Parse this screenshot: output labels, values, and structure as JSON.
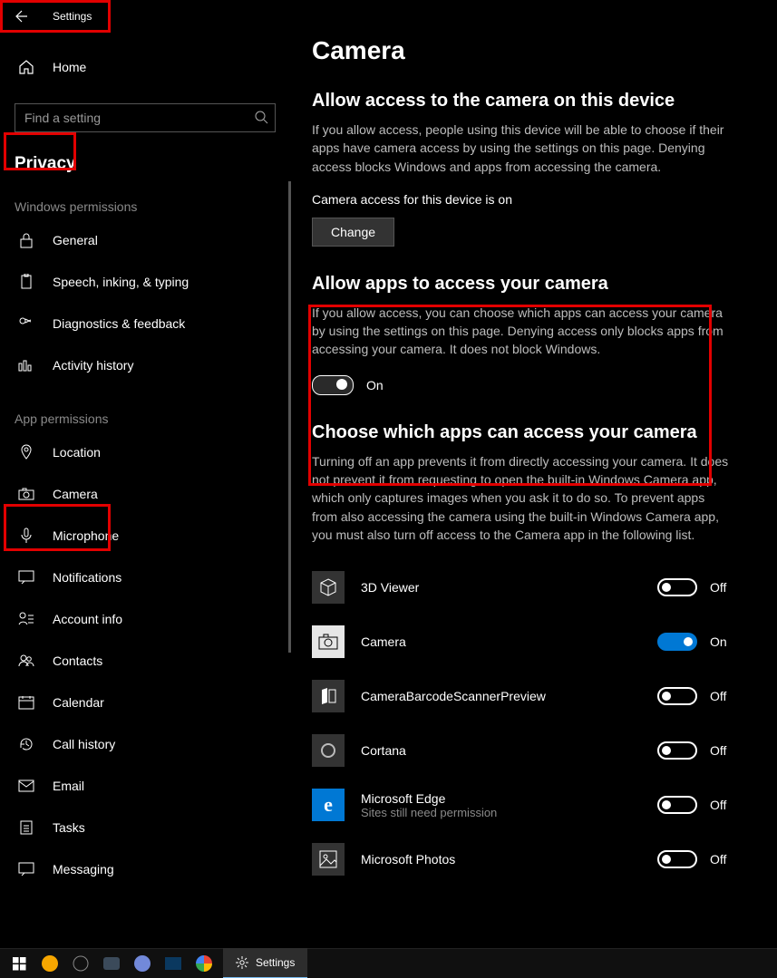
{
  "titlebar": {
    "title": "Settings"
  },
  "sidebar": {
    "home": "Home",
    "search_placeholder": "Find a setting",
    "crumb": "Privacy",
    "section1_label": "Windows permissions",
    "section1_items": [
      {
        "label": "General"
      },
      {
        "label": "Speech, inking, & typing"
      },
      {
        "label": "Diagnostics & feedback"
      },
      {
        "label": "Activity history"
      }
    ],
    "section2_label": "App permissions",
    "section2_items": [
      {
        "label": "Location"
      },
      {
        "label": "Camera"
      },
      {
        "label": "Microphone"
      },
      {
        "label": "Notifications"
      },
      {
        "label": "Account info"
      },
      {
        "label": "Contacts"
      },
      {
        "label": "Calendar"
      },
      {
        "label": "Call history"
      },
      {
        "label": "Email"
      },
      {
        "label": "Tasks"
      },
      {
        "label": "Messaging"
      }
    ]
  },
  "page": {
    "title": "Camera",
    "s1": {
      "heading": "Allow access to the camera on this device",
      "para": "If you allow access, people using this device will be able to choose if their apps have camera access by using the settings on this page. Denying access blocks Windows and apps from accessing the camera.",
      "status": "Camera access for this device is on",
      "button": "Change"
    },
    "s2": {
      "heading": "Allow apps to access your camera",
      "para": "If you allow access, you can choose which apps can access your camera by using the settings on this page. Denying access only blocks apps from accessing your camera. It does not block Windows.",
      "toggle_label": "On"
    },
    "s3": {
      "heading": "Choose which apps can access your camera",
      "para": "Turning off an app prevents it from directly accessing your camera. It does not prevent it from requesting to open the built-in Windows Camera app, which only captures images when you ask it to do so. To prevent apps from also accessing the camera using the built-in Windows Camera app, you must also turn off access to the Camera app in the following list.",
      "apps": [
        {
          "name": "3D Viewer",
          "state": "Off",
          "on": false
        },
        {
          "name": "Camera",
          "state": "On",
          "on": true
        },
        {
          "name": "CameraBarcodeScannerPreview",
          "state": "Off",
          "on": false
        },
        {
          "name": "Cortana",
          "state": "Off",
          "on": false
        },
        {
          "name": "Microsoft Edge",
          "sub": "Sites still need permission",
          "state": "Off",
          "on": false
        },
        {
          "name": "Microsoft Photos",
          "state": "Off",
          "on": false
        }
      ]
    }
  },
  "taskbar": {
    "app": "Settings"
  }
}
